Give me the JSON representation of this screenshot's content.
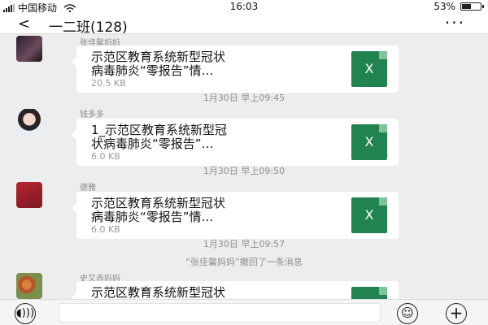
{
  "status_bar": {
    "carrier": "中国移动",
    "time": "16:03",
    "battery": "53%",
    "battery_level": 0.53
  },
  "nav": {
    "title": "一二班(128)",
    "back_icon": "chevron-left-icon",
    "more_icon": "more-dots-icon"
  },
  "messages": [
    {
      "sender": "张佳馨妈妈",
      "file_name": "示范区教育系统新型冠状\n病毒肺炎“零报告”情…",
      "file_size": "20.5 KB"
    },
    {
      "sender": "钱多多",
      "file_name": "1_示范区教育系统新型冠\n状病毒肺炎“零报告”…",
      "file_size": "6.0 KB"
    },
    {
      "sender": "德雅",
      "file_name": "示范区教育系统新型冠状\n病毒肺炎“零报告”情…",
      "file_size": "6.0 KB"
    },
    {
      "sender": "史又赤妈妈",
      "file_name": "示范区教育系统新型冠状\n病毒肺炎“零报告”情…",
      "file_size": ""
    }
  ],
  "timestamps": [
    "1月30日 早上09:45",
    "1月30日 早上09:50",
    "1月30日 早上09:57"
  ],
  "system_message": "“张佳馨妈妈”撤回了一条消息",
  "file_icon_label": "X",
  "colors": {
    "excel_green": "#21834f",
    "chat_bg": "#ededed"
  },
  "input_bar": {
    "voice_icon": "voice-icon",
    "emoji_icon": "emoji-icon",
    "plus_icon": "plus-icon",
    "voice_glyph": "◖)))",
    "emoji_glyph": "☺",
    "plus_glyph": "+"
  }
}
